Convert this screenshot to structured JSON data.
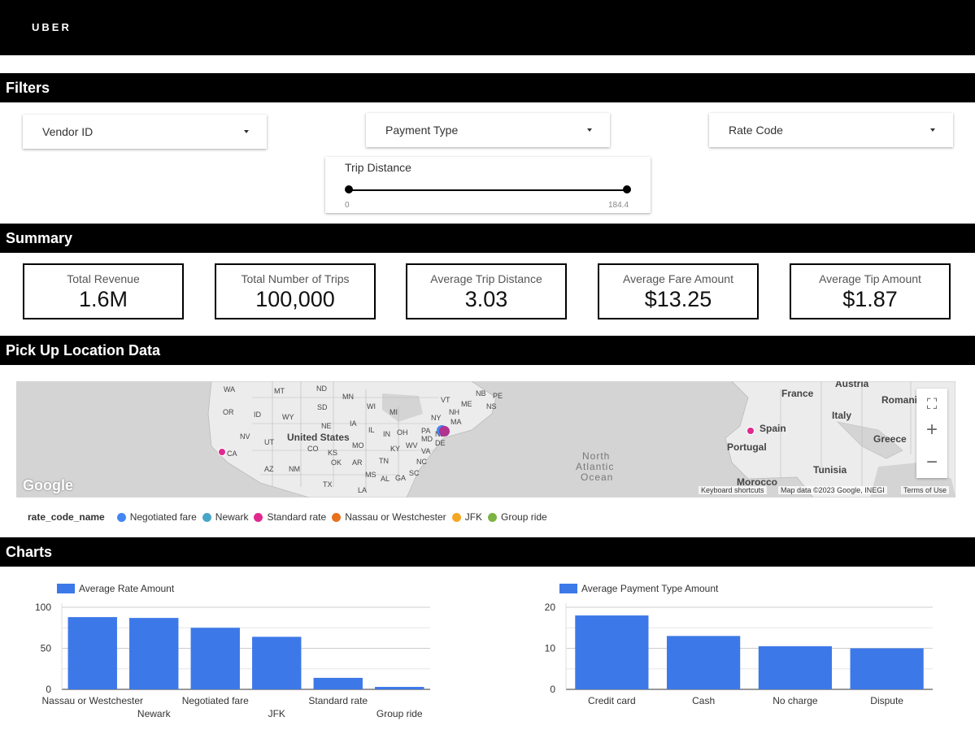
{
  "header": {
    "logo": "UBER"
  },
  "sections": {
    "filters": "Filters",
    "summary": "Summary",
    "map": "Pick Up Location Data",
    "charts": "Charts"
  },
  "filters": {
    "dropdowns": [
      "Vendor ID",
      "Payment Type",
      "Rate Code"
    ],
    "slider": {
      "label": "Trip Distance",
      "min": "0",
      "max": "184.4"
    }
  },
  "kpis": [
    {
      "label": "Total Revenue",
      "value": "1.6M"
    },
    {
      "label": "Total Number of Trips",
      "value": "100,000"
    },
    {
      "label": "Average Trip Distance",
      "value": "3.03"
    },
    {
      "label": "Average Fare Amount",
      "value": "$13.25"
    },
    {
      "label": "Average Tip Amount",
      "value": "$1.87"
    }
  ],
  "map": {
    "labels": [
      "WA",
      "MT",
      "ND",
      "MN",
      "OR",
      "ID",
      "SD",
      "WI",
      "MI",
      "NY",
      "VT",
      "NH",
      "ME",
      "NB",
      "PE",
      "NS",
      "MA",
      "WY",
      "NE",
      "IA",
      "IL",
      "IN",
      "OH",
      "PA",
      "NJ",
      "NV",
      "UT",
      "CO",
      "KS",
      "MO",
      "KY",
      "WV",
      "VA",
      "DE",
      "MD",
      "CA",
      "AZ",
      "NM",
      "OK",
      "AR",
      "TN",
      "NC",
      "SC",
      "MS",
      "AL",
      "GA",
      "TX",
      "LA",
      "United States",
      "North",
      "Atlantic",
      "Ocean",
      "France",
      "Austria",
      "Romania",
      "Italy",
      "Spain",
      "Portugal",
      "Greece",
      "Morocco",
      "Tunisia"
    ],
    "google": "Google",
    "footer": {
      "shortcuts": "Keyboard shortcuts",
      "mapdata": "Map data ©2023 Google, INEGI",
      "terms": "Terms of Use"
    },
    "controls": {
      "fullscreen": "⛶",
      "zoom_in": "+",
      "zoom_out": "−"
    }
  },
  "legend": {
    "title": "rate_code_name",
    "items": [
      {
        "name": "Negotiated fare",
        "color": "#4285f4"
      },
      {
        "name": "Newark",
        "color": "#4aa6c8"
      },
      {
        "name": "Standard rate",
        "color": "#e0288f"
      },
      {
        "name": "Nassau or Westchester",
        "color": "#e8711c"
      },
      {
        "name": "JFK",
        "color": "#f5a623"
      },
      {
        "name": "Group ride",
        "color": "#7cb342"
      }
    ]
  },
  "chart_data": [
    {
      "type": "bar",
      "legend": "Average Rate Amount",
      "categories": [
        "Nassau or Westchester",
        "Newark",
        "Negotiated fare",
        "JFK",
        "Standard rate",
        "Group ride"
      ],
      "values": [
        88,
        87,
        75,
        64,
        14,
        3
      ],
      "yticks": [
        0,
        50,
        100
      ],
      "ylim": [
        0,
        100
      ],
      "color": "#3d78e8"
    },
    {
      "type": "bar",
      "legend": "Average Payment Type Amount",
      "categories": [
        "Credit card",
        "Cash",
        "No charge",
        "Dispute"
      ],
      "values": [
        18,
        13,
        10.5,
        10
      ],
      "yticks": [
        0,
        10,
        20
      ],
      "ylim": [
        0,
        20
      ],
      "color": "#3d78e8"
    }
  ]
}
